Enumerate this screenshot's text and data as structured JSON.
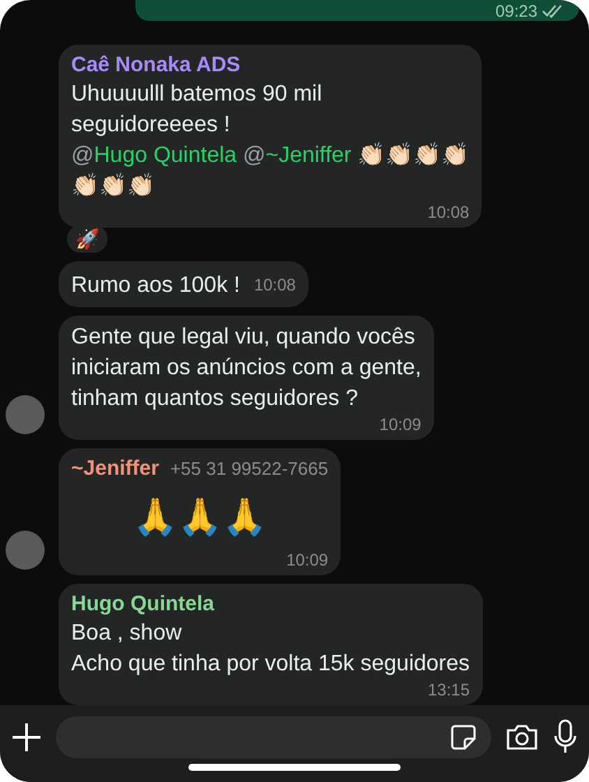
{
  "outgoing": {
    "time": "09:23",
    "read": true
  },
  "messages": [
    {
      "kind": "text",
      "sender": "Caê Nonaka ADS",
      "color": "#a78bfa",
      "parts": [
        {
          "kind": "plain",
          "text": "Uhuuuulll batemos 90 mil\nseguidoreeees !\n"
        },
        {
          "kind": "at",
          "text": "@"
        },
        {
          "kind": "mention",
          "text": "Hugo Quintela"
        },
        {
          "kind": "at",
          "text": " @"
        },
        {
          "kind": "mention",
          "text": "~Jeniffer"
        },
        {
          "kind": "plain",
          "text": " 👏🏻👏🏻👏🏻👏🏻\n👏🏻👏🏻👏🏻"
        }
      ],
      "time": "10:08",
      "avatar": false,
      "reaction": "🚀"
    },
    {
      "kind": "text",
      "parts": [
        {
          "kind": "plain",
          "text": "Rumo aos 100k !"
        }
      ],
      "time": "10:08",
      "avatar": false
    },
    {
      "kind": "text",
      "parts": [
        {
          "kind": "plain",
          "text": "Gente que legal viu, quando vocês\niniciaram os anúncios com a gente,\ntinham quantos seguidores ?"
        }
      ],
      "time": "10:09",
      "avatar": true
    },
    {
      "kind": "emoji",
      "sender": "~Jeniffer",
      "color": "#f0937a",
      "phone": "+55 31 99522-7665",
      "parts": [
        {
          "kind": "plain",
          "text": "🙏🙏🙏"
        }
      ],
      "time": "10:09",
      "avatar": true
    },
    {
      "kind": "text",
      "sender": "Hugo Quintela",
      "color": "#86d993",
      "parts": [
        {
          "kind": "plain",
          "text": "Boa , show\nAcho que tinha por volta 15k seguidores"
        }
      ],
      "time": "13:15",
      "avatar": false
    }
  ]
}
